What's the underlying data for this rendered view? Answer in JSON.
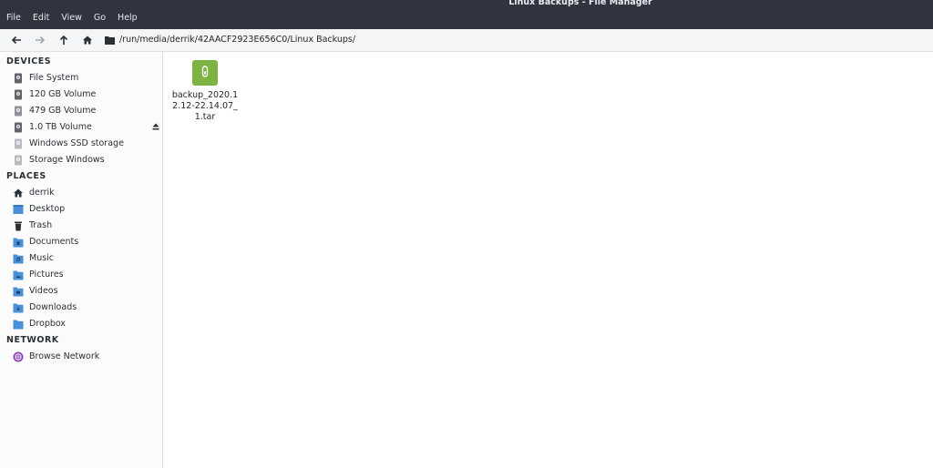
{
  "window": {
    "title": "Linux Backups - File Manager"
  },
  "menubar": [
    "File",
    "Edit",
    "View",
    "Go",
    "Help"
  ],
  "toolbar": {
    "path": "/run/media/derrik/42AACF2923E656C0/Linux Backups/"
  },
  "sidebar": {
    "devices_title": "DEVICES",
    "devices": [
      {
        "label": "File System",
        "icon": "drive-icon"
      },
      {
        "label": "120 GB Volume",
        "icon": "drive-icon"
      },
      {
        "label": "479 GB Volume",
        "icon": "drive-icon"
      },
      {
        "label": "1.0 TB Volume",
        "icon": "drive-icon",
        "eject": true
      },
      {
        "label": "Windows SSD storage",
        "icon": "drive-icon"
      },
      {
        "label": "Storage Windows",
        "icon": "drive-icon"
      }
    ],
    "places_title": "PLACES",
    "places": [
      {
        "label": "derrik",
        "icon": "home-icon"
      },
      {
        "label": "Desktop",
        "icon": "desktop-icon"
      },
      {
        "label": "Trash",
        "icon": "trash-icon"
      },
      {
        "label": "Documents",
        "icon": "folder-documents-icon"
      },
      {
        "label": "Music",
        "icon": "folder-music-icon"
      },
      {
        "label": "Pictures",
        "icon": "folder-pictures-icon"
      },
      {
        "label": "Videos",
        "icon": "folder-videos-icon"
      },
      {
        "label": "Downloads",
        "icon": "folder-downloads-icon"
      },
      {
        "label": "Dropbox",
        "icon": "folder-icon"
      }
    ],
    "network_title": "NETWORK",
    "network": [
      {
        "label": "Browse Network",
        "icon": "network-icon"
      }
    ]
  },
  "files": [
    {
      "name": "backup_2020.12.12-22.14.07_1.tar",
      "icon": "archive-icon",
      "color": "#7cb342"
    }
  ]
}
